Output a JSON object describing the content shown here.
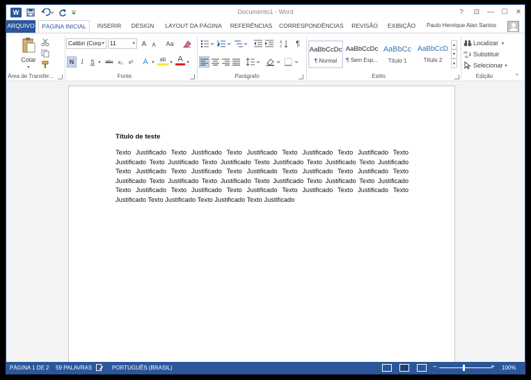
{
  "titlebar": {
    "document_title": "Documento1 - Word",
    "help": "?",
    "ribbon_options": "⊡",
    "minimize": "—",
    "maximize": "☐",
    "close": "✕",
    "qat_logo": "W"
  },
  "tabs": [
    {
      "label": "ARQUIVO"
    },
    {
      "label": "PÁGINA INICIAL"
    },
    {
      "label": "INSERIR"
    },
    {
      "label": "DESIGN"
    },
    {
      "label": "LAYOUT DA PÁGINA"
    },
    {
      "label": "REFERÊNCIAS"
    },
    {
      "label": "CORRESPONDÊNCIAS"
    },
    {
      "label": "REVISÃO"
    },
    {
      "label": "EXIBIÇÃO"
    }
  ],
  "user": {
    "name": "Paulo Henrique Alan Santos"
  },
  "ribbon": {
    "clipboard": {
      "paste_label": "Colar",
      "group_label": "Área de Transfer..."
    },
    "font": {
      "font_name": "Calibri (Corp",
      "font_size": "11",
      "group_label": "Fonte",
      "grow": "A",
      "shrink": "A",
      "case": "Aa",
      "bold": "N",
      "italic": "I",
      "underline": "S",
      "strike": "abc",
      "subscript": "x₂",
      "superscript": "x²",
      "effects": "A",
      "highlight": "ab",
      "font_color": "A"
    },
    "paragraph": {
      "group_label": "Parágrafo",
      "pilcrow": "¶"
    },
    "styles": {
      "group_label": "Estilo",
      "items": [
        {
          "preview": "AaBbCcDc",
          "name": "¶ Normal"
        },
        {
          "preview": "AaBbCcDc",
          "name": "¶ Sem Esp..."
        },
        {
          "preview": "AaBbCc",
          "name": "Título 1"
        },
        {
          "preview": "AaBbCcD",
          "name": "Título 2"
        }
      ]
    },
    "editing": {
      "group_label": "Edição",
      "find": "Localizar",
      "replace": "Substituir",
      "select": "Selecionar"
    }
  },
  "document": {
    "heading": "Título de teste",
    "body": "Texto Justificado Texto Justificado Texto Justificado Texto Justificado Texto Justificado Texto Justificado Texto Justificado Texto Justificado Texto Justificado Texto Justificado Texto Justificado Texto Justificado Texto Justificado Texto Justificado Texto Justificado Texto Justificado Texto Justificado Texto Justificado Texto Justificado Texto Justificado Texto Justificado Texto Justificado Texto Justificado Texto Justificado Texto Justificado Texto Justificado Texto Justificado Texto Justificado Texto Justificado Texto Justificado Texto Justificado"
  },
  "status": {
    "page": "PÁGINA 1 DE 2",
    "words": "59 PALAVRAS",
    "language": "PORTUGUÊS (BRASIL)",
    "zoom": "100%",
    "zoom_minus": "−",
    "zoom_plus": "+"
  },
  "colors": {
    "accent": "#2b579a",
    "heading_style": "#2e74b5"
  }
}
